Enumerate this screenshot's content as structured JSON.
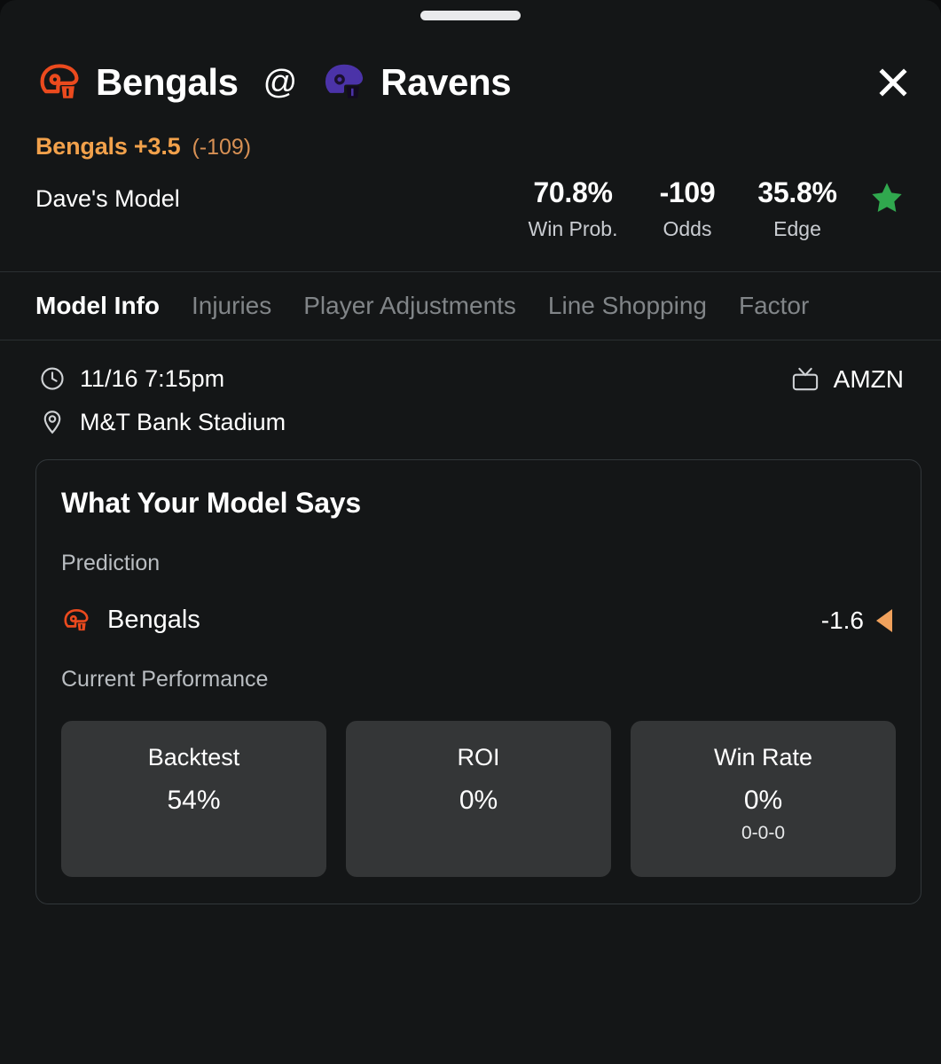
{
  "sheet": {
    "drag_handle": "drag-handle"
  },
  "header": {
    "away_team": "Bengals",
    "at": "@",
    "home_team": "Ravens",
    "away_helmet_color": "#EB4A1E",
    "home_helmet_color": "#4B33A8",
    "close_label": "Close"
  },
  "pick": {
    "selection": "Bengals +3.5",
    "odds": "(-109)",
    "accent_color": "#F2A14B"
  },
  "model": {
    "name": "Dave's Model",
    "stats": [
      {
        "value": "70.8%",
        "label": "Win Prob."
      },
      {
        "value": "-109",
        "label": "Odds"
      },
      {
        "value": "35.8%",
        "label": "Edge"
      }
    ],
    "star_color": "#30A84E"
  },
  "tabs": [
    {
      "label": "Model Info",
      "active": true
    },
    {
      "label": "Injuries",
      "active": false
    },
    {
      "label": "Player Adjustments",
      "active": false
    },
    {
      "label": "Line Shopping",
      "active": false
    },
    {
      "label": "Factor",
      "active": false
    }
  ],
  "meta": {
    "datetime": "11/16 7:15pm",
    "venue": "M&T Bank Stadium",
    "broadcast": "AMZN"
  },
  "card": {
    "title": "What Your Model Says",
    "prediction_label": "Prediction",
    "prediction_team": "Bengals",
    "prediction_value": "-1.6",
    "performance_label": "Current Performance",
    "performance": [
      {
        "label": "Backtest",
        "value": "54%",
        "sub": ""
      },
      {
        "label": "ROI",
        "value": "0%",
        "sub": ""
      },
      {
        "label": "Win Rate",
        "value": "0%",
        "sub": "0-0-0"
      }
    ]
  }
}
